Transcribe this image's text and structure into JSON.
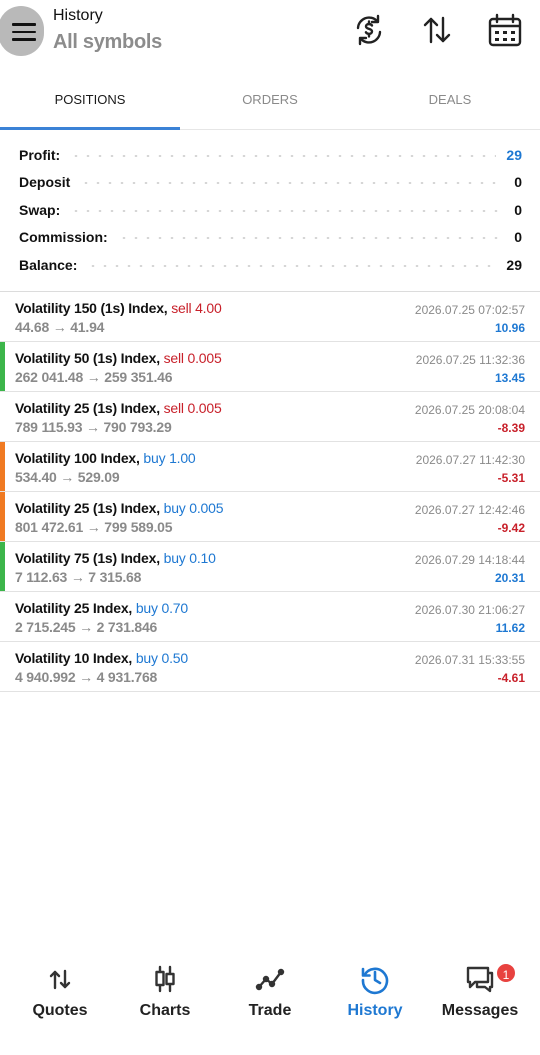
{
  "header": {
    "title": "History",
    "subtitle": "All symbols"
  },
  "tabs": [
    {
      "label": "POSITIONS",
      "active": true
    },
    {
      "label": "ORDERS",
      "active": false
    },
    {
      "label": "DEALS",
      "active": false
    }
  ],
  "summary": [
    {
      "label": "Profit:",
      "value": "29"
    },
    {
      "label": "Deposit",
      "value": "0"
    },
    {
      "label": "Swap:",
      "value": "0"
    },
    {
      "label": "Commission:",
      "value": "0"
    },
    {
      "label": "Balance:",
      "value": "29"
    }
  ],
  "deals": [
    {
      "symbol": "Volatility 150 (1s) Index,",
      "op": "sell 4.00",
      "prices": "44.68 → 41.94",
      "time": "2026.07.25 07:02:57",
      "profit": "10.96",
      "bar": ""
    },
    {
      "symbol": "Volatility 50 (1s) Index,",
      "op": "sell 0.005",
      "prices": "262 041.48 → 259 351.46",
      "time": "2026.07.25 11:32:36",
      "profit": "13.45",
      "bar": "#3cb54a"
    },
    {
      "symbol": "Volatility 25 (1s) Index,",
      "op": "sell 0.005",
      "prices": "789 115.93 → 790 793.29",
      "time": "2026.07.25 20:08:04",
      "profit": "-8.39",
      "bar": ""
    },
    {
      "symbol": "Volatility 100 Index,",
      "op": "buy 1.00",
      "prices": "534.40 → 529.09",
      "time": "2026.07.27 11:42:30",
      "profit": "-5.31",
      "bar": "#f07a22"
    },
    {
      "symbol": "Volatility 25 (1s) Index,",
      "op": "buy 0.005",
      "prices": "801 472.61 → 799 589.05",
      "time": "2026.07.27 12:42:46",
      "profit": "-9.42",
      "bar": "#f07a22"
    },
    {
      "symbol": "Volatility 75 (1s) Index,",
      "op": "buy 0.10",
      "prices": "7 112.63 → 7 315.68",
      "time": "2026.07.29 14:18:44",
      "profit": "20.31",
      "bar": "#3cb54a"
    },
    {
      "symbol": "Volatility 25 Index,",
      "op": "buy 0.70",
      "prices": "2 715.245 → 2 731.846",
      "time": "2026.07.30 21:06:27",
      "profit": "11.62",
      "bar": ""
    },
    {
      "symbol": "Volatility 10 Index,",
      "op": "buy 0.50",
      "prices": "4 940.992 → 4 931.768",
      "time": "2026.07.31 15:33:55",
      "profit": "-4.61",
      "bar": ""
    }
  ],
  "nav": [
    {
      "label": "Quotes",
      "icon": "quotes-icon",
      "active": false
    },
    {
      "label": "Charts",
      "icon": "charts-icon",
      "active": false
    },
    {
      "label": "Trade",
      "icon": "trade-icon",
      "active": false
    },
    {
      "label": "History",
      "icon": "history-icon",
      "active": true
    },
    {
      "label": "Messages",
      "icon": "messages-icon",
      "active": false,
      "badge": "1"
    }
  ],
  "colors": {
    "accent": "#1e78d2",
    "loss": "#c8202a",
    "bar_green": "#3cb54a",
    "bar_orange": "#f07a22"
  }
}
